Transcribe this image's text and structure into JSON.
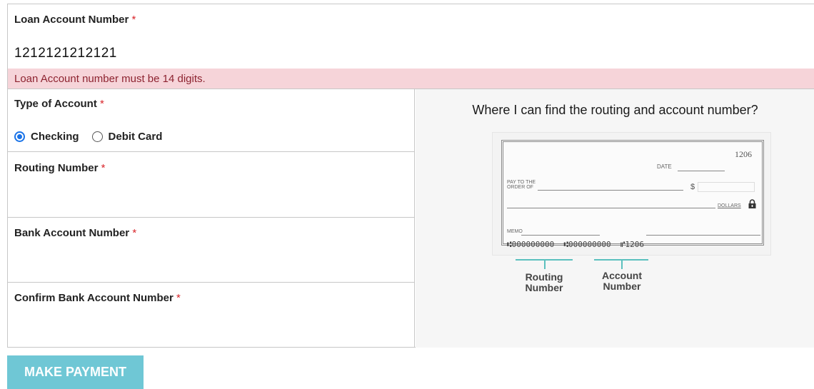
{
  "loan": {
    "label": "Loan Account Number",
    "required_mark": "*",
    "value": "1212121212121",
    "error": "Loan Account number must be 14 digits."
  },
  "account_type": {
    "label": "Type of Account",
    "required_mark": "*",
    "options": [
      {
        "label": "Checking",
        "selected": true
      },
      {
        "label": "Debit Card",
        "selected": false
      }
    ]
  },
  "routing": {
    "label": "Routing Number",
    "required_mark": "*",
    "value": ""
  },
  "bank_account": {
    "label": "Bank Account Number",
    "required_mark": "*",
    "value": ""
  },
  "confirm_bank_account": {
    "label": "Confirm Bank Account Number",
    "required_mark": "*",
    "value": ""
  },
  "help": {
    "title": "Where I can find the routing and account number?",
    "check": {
      "number": "1206",
      "date_label": "DATE",
      "pay_to_line1": "PAY TO THE",
      "pay_to_line2": "ORDER OF",
      "dollar_sign": "$",
      "dollars_label": "DOLLARS",
      "memo_label": "MEMO",
      "micr": "⑆000000000  ⑆000000000  ⑈1206"
    },
    "routing_label_1": "Routing",
    "routing_label_2": "Number",
    "account_label_1": "Account",
    "account_label_2": "Number"
  },
  "submit": {
    "label": "MAKE PAYMENT"
  },
  "colors": {
    "accent": "#1a73e8",
    "error_bg": "#f6d4d9",
    "error_text": "#8d2330",
    "required": "#d9262b",
    "button": "#6fc7d5",
    "bracket": "#5bc0be"
  }
}
